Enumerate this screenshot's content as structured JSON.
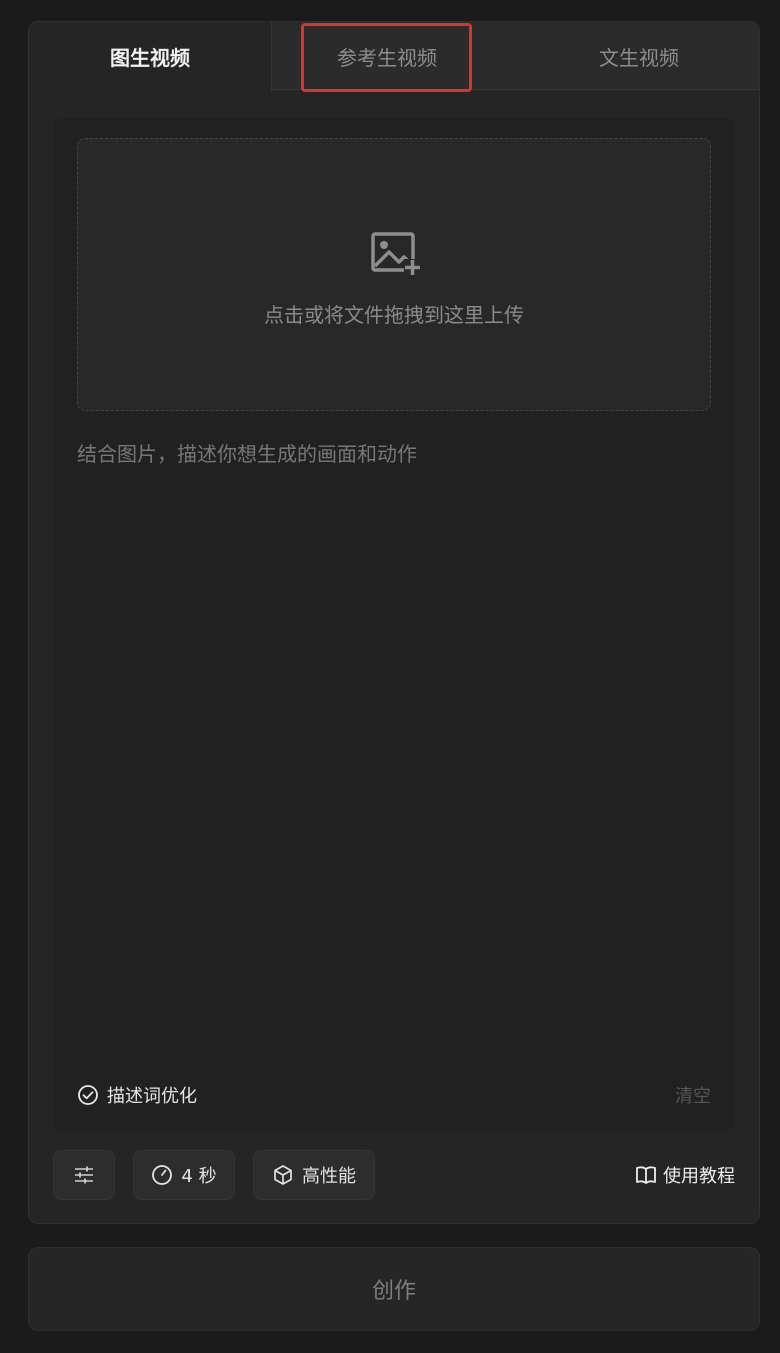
{
  "tabs": [
    {
      "label": "图生视频",
      "active": true
    },
    {
      "label": "参考生视频",
      "active": false,
      "highlighted": true
    },
    {
      "label": "文生视频",
      "active": false
    }
  ],
  "upload": {
    "icon": "image-add-icon",
    "hint": "点击或将文件拖拽到这里上传"
  },
  "prompt": {
    "placeholder": "结合图片，描述你想生成的画面和动作",
    "value": ""
  },
  "optimize": {
    "icon": "check-circle-icon",
    "label": "描述词优化"
  },
  "clear_label": "清空",
  "toolbar": {
    "settings_icon": "sliders-icon",
    "duration": {
      "icon": "timer-icon",
      "label": "4 秒"
    },
    "mode": {
      "icon": "cube-icon",
      "label": "高性能"
    },
    "tutorial": {
      "icon": "book-icon",
      "label": "使用教程"
    }
  },
  "create_label": "创作",
  "colors": {
    "background": "#1b1b1b",
    "panel": "#252525",
    "highlight_outline": "#e0312b",
    "active_tab_text": "#f2f2f2",
    "inactive_tab_text": "#8d8d8d"
  }
}
